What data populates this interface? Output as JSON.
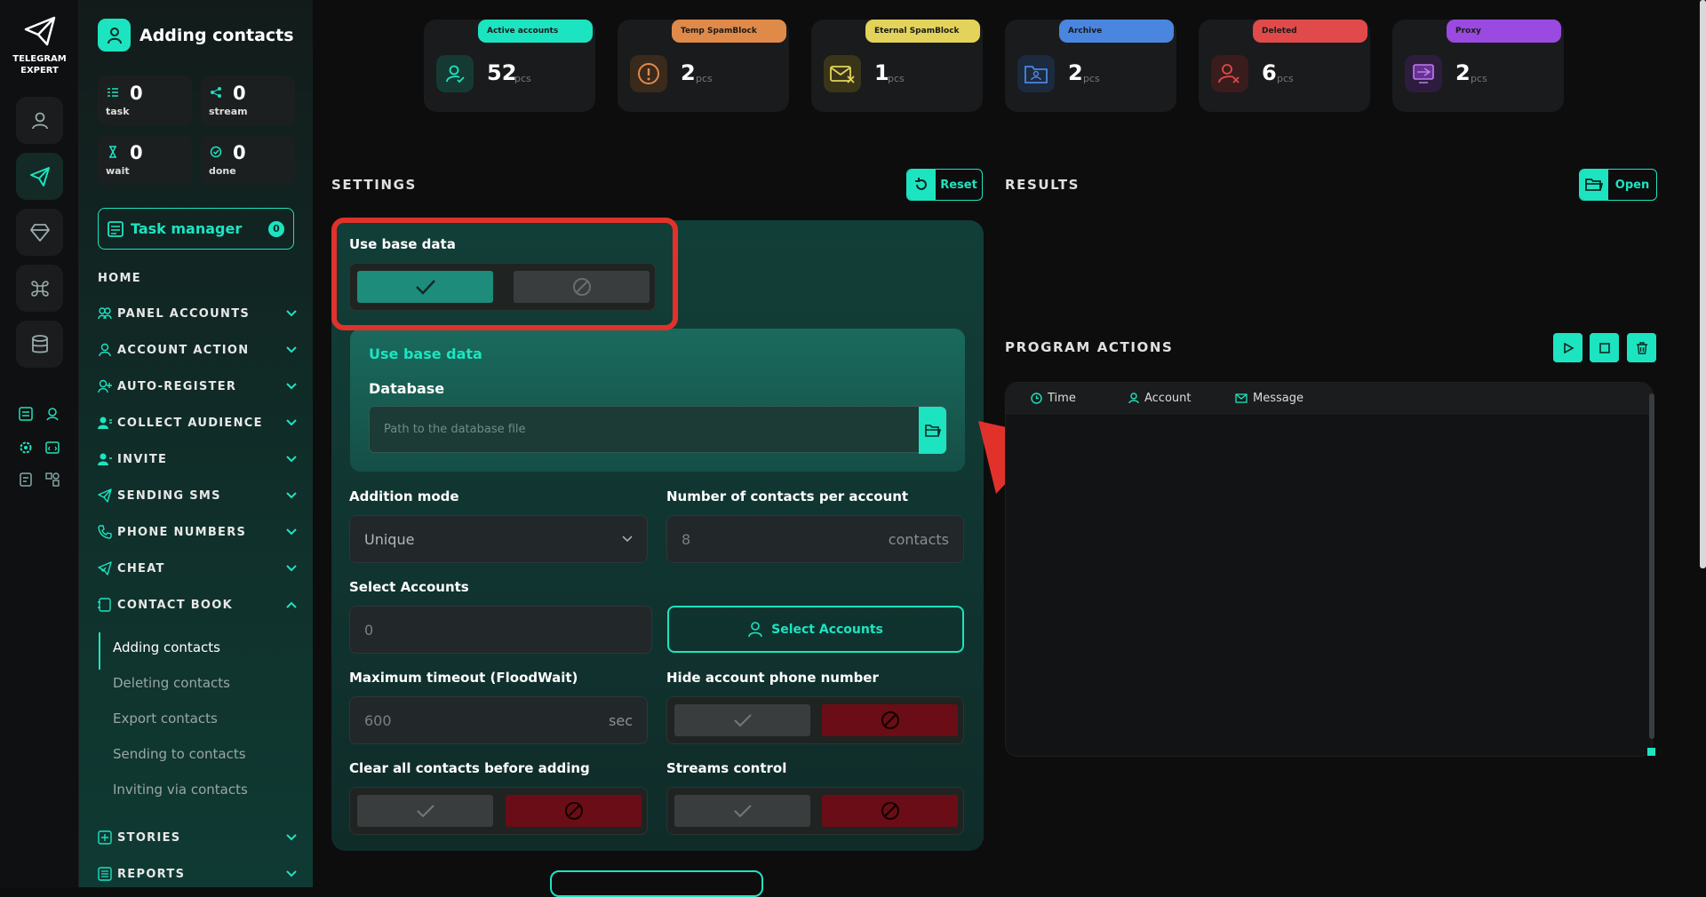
{
  "brand": {
    "line1": "TELEGRAM",
    "line2": "EXPERT"
  },
  "sidebar": {
    "title": "Adding contacts",
    "stats": [
      {
        "value": "0",
        "label": "task"
      },
      {
        "value": "0",
        "label": "stream"
      },
      {
        "value": "0",
        "label": "wait"
      },
      {
        "value": "0",
        "label": "done"
      }
    ],
    "task_manager": {
      "label": "Task manager",
      "count": "0"
    },
    "home": "HOME",
    "nav": [
      {
        "label": "PANEL ACCOUNTS"
      },
      {
        "label": "ACCOUNT ACTION"
      },
      {
        "label": "AUTO-REGISTER"
      },
      {
        "label": "COLLECT AUDIENCE"
      },
      {
        "label": "INVITE"
      },
      {
        "label": "SENDING SMS"
      },
      {
        "label": "PHONE NUMBERS"
      },
      {
        "label": "CHEAT"
      },
      {
        "label": "CONTACT BOOK"
      }
    ],
    "contact_book_items": [
      "Adding contacts",
      "Deleting contacts",
      "Export contacts",
      "Sending to contacts",
      "Inviting via contacts"
    ],
    "nav_bottom": [
      {
        "label": "STORIES"
      },
      {
        "label": "REPORTS"
      }
    ]
  },
  "cards": [
    {
      "pill": "Active accounts",
      "color": "#1de4c0",
      "value": "52",
      "unit": "pcs"
    },
    {
      "pill": "Temp SpamBlock",
      "color": "#e08a4a",
      "value": "2",
      "unit": "pcs"
    },
    {
      "pill": "Eternal SpamBlock",
      "color": "#e3d35a",
      "value": "1",
      "unit": "pcs"
    },
    {
      "pill": "Archive",
      "color": "#4a86e0",
      "value": "2",
      "unit": "pcs"
    },
    {
      "pill": "Deleted",
      "color": "#e04a4a",
      "value": "6",
      "unit": "pcs"
    },
    {
      "pill": "Proxy",
      "color": "#9a4ae0",
      "value": "2",
      "unit": "pcs"
    }
  ],
  "settings": {
    "title": "SETTINGS",
    "reset": "Reset",
    "use_base_data": "Use base data",
    "sub_title": "Use base data",
    "database_label": "Database",
    "database_placeholder": "Path to the database file",
    "addition_mode_label": "Addition mode",
    "addition_mode_value": "Unique",
    "contacts_per_account_label": "Number of contacts per account",
    "contacts_per_account_value": "8",
    "contacts_unit": "contacts",
    "select_accounts_label": "Select Accounts",
    "select_accounts_value": "0",
    "select_accounts_button": "Select Accounts",
    "max_timeout_label": "Maximum timeout (FloodWait)",
    "max_timeout_value": "600",
    "timeout_unit": "sec",
    "hide_phone_label": "Hide account phone number",
    "clear_contacts_label": "Clear all contacts before adding",
    "streams_control_label": "Streams control"
  },
  "results": {
    "title": "RESULTS",
    "open": "Open"
  },
  "program_actions": {
    "title": "PROGRAM ACTIONS",
    "columns": [
      "Time",
      "Account",
      "Message"
    ]
  }
}
